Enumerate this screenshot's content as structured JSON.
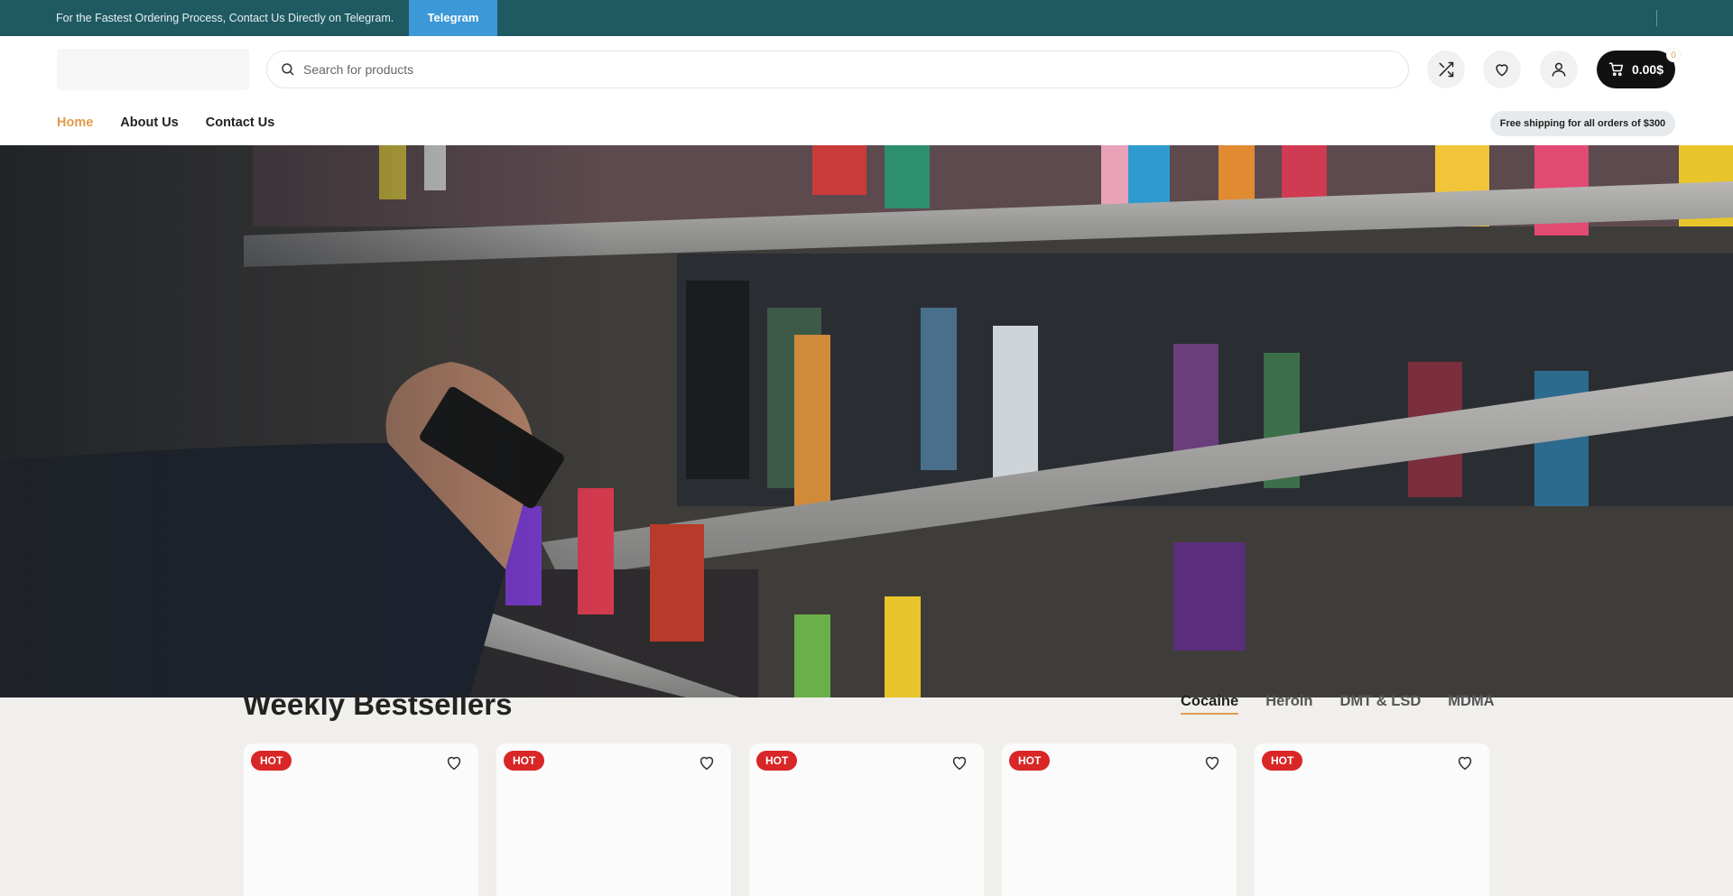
{
  "topbar": {
    "message": " For the Fastest Ordering Process, Contact Us Directly on Telegram.",
    "telegram_label": "Telegram"
  },
  "header": {
    "search_placeholder": "Search for products",
    "cart_total": "0.00$",
    "cart_count": "0",
    "shipping_note": "Free shipping for all orders of $300"
  },
  "nav": {
    "items": [
      {
        "label": "Home",
        "active": true
      },
      {
        "label": "About Us",
        "active": false
      },
      {
        "label": "Contact Us",
        "active": false
      }
    ]
  },
  "bestsellers": {
    "title": "Weekly Bestsellers",
    "tabs": [
      "Cocaine",
      "Heroin",
      "DMT & LSD",
      "MDMA"
    ],
    "active_tab": "Cocaine",
    "cards": [
      {
        "badge": "HOT"
      },
      {
        "badge": "HOT"
      },
      {
        "badge": "HOT"
      },
      {
        "badge": "HOT"
      },
      {
        "badge": "HOT"
      }
    ]
  },
  "icons": {
    "search": "search-icon",
    "compare": "shuffle-icon",
    "wishlist": "heart-icon",
    "account": "user-icon",
    "cart": "cart-icon"
  },
  "colors": {
    "topbar_bg": "#1f5a63",
    "telegram_btn": "#3c98d6",
    "accent": "#e19a4c",
    "badge": "#d92626",
    "cart_btn": "#111111"
  }
}
